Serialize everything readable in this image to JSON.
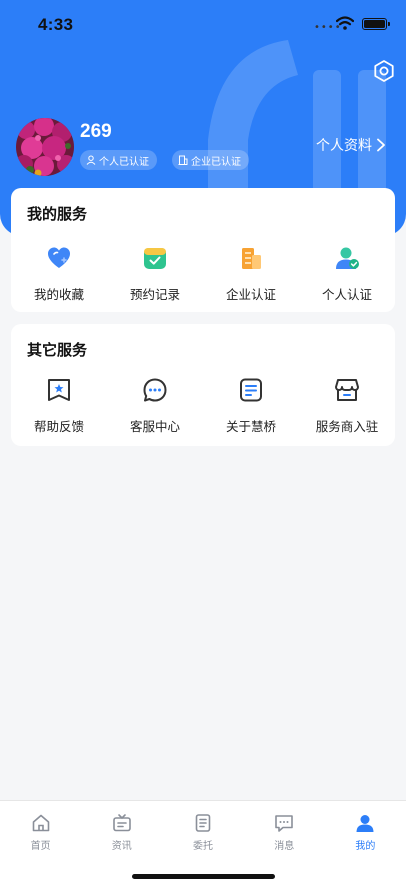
{
  "status_bar": {
    "time": "4:33",
    "signal": "••••"
  },
  "colors": {
    "brand": "#2c7ef8",
    "tab_inactive": "#8a8f99"
  },
  "profile": {
    "name": "269",
    "badge_personal": "个人已认证",
    "badge_company": "企业已认证",
    "profile_link": "个人资料"
  },
  "my_services": {
    "title": "我的服务",
    "items": [
      {
        "label": "我的收藏",
        "icon": "heart-icon"
      },
      {
        "label": "预约记录",
        "icon": "calendar-check-icon"
      },
      {
        "label": "企业认证",
        "icon": "building-icon"
      },
      {
        "label": "个人认证",
        "icon": "user-verified-icon"
      }
    ]
  },
  "other_services": {
    "title": "其它服务",
    "items": [
      {
        "label": "帮助反馈",
        "icon": "feedback-icon"
      },
      {
        "label": "客服中心",
        "icon": "chat-bubble-icon"
      },
      {
        "label": "关于慧桥",
        "icon": "document-icon"
      },
      {
        "label": "服务商入驻",
        "icon": "store-icon"
      }
    ]
  },
  "tabbar": {
    "items": [
      {
        "label": "首页",
        "icon": "home-icon"
      },
      {
        "label": "资讯",
        "icon": "news-icon"
      },
      {
        "label": "委托",
        "icon": "clipboard-icon"
      },
      {
        "label": "消息",
        "icon": "message-icon"
      },
      {
        "label": "我的",
        "icon": "user-icon",
        "active": true
      }
    ]
  }
}
